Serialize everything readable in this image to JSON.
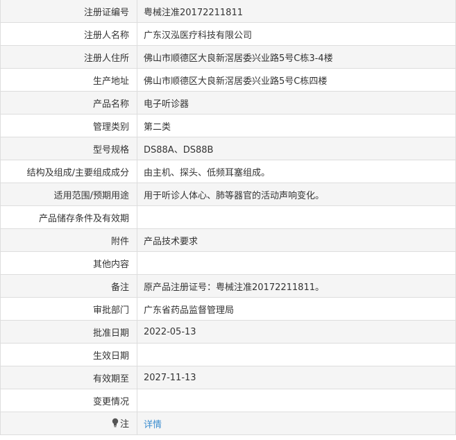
{
  "rows": [
    {
      "label": "注册证编号",
      "value": "粤械注准20172211811"
    },
    {
      "label": "注册人名称",
      "value": "广东汉泓医疗科技有限公司"
    },
    {
      "label": "注册人住所",
      "value": "佛山市顺德区大良新滘居委兴业路5号C栋3-4楼"
    },
    {
      "label": "生产地址",
      "value": "佛山市顺德区大良新滘居委兴业路5号C栋四楼"
    },
    {
      "label": "产品名称",
      "value": "电子听诊器"
    },
    {
      "label": "管理类别",
      "value": "第二类"
    },
    {
      "label": "型号规格",
      "value": "DS88A、DS88B"
    },
    {
      "label": "结构及组成/主要组成成分",
      "value": "由主机、探头、低频耳塞组成。"
    },
    {
      "label": "适用范围/预期用途",
      "value": "用于听诊人体心、肺等器官的活动声响变化。"
    },
    {
      "label": "产品储存条件及有效期",
      "value": ""
    },
    {
      "label": "附件",
      "value": "产品技术要求"
    },
    {
      "label": "其他内容",
      "value": ""
    },
    {
      "label": "备注",
      "value": "原产品注册证号：粤械注准20172211811。"
    },
    {
      "label": "审批部门",
      "value": "广东省药品监督管理局"
    },
    {
      "label": "批准日期",
      "value": "2022-05-13"
    },
    {
      "label": "生效日期",
      "value": ""
    },
    {
      "label": "有效期至",
      "value": "2027-11-13"
    },
    {
      "label": "变更情况",
      "value": ""
    }
  ],
  "note": {
    "label": "注",
    "link_text": "详情",
    "icon": "lightbulb-icon"
  },
  "colors": {
    "border": "#dddddd",
    "label_bg": "#f5f5f5",
    "link": "#3c8dcf",
    "text": "#333333"
  }
}
